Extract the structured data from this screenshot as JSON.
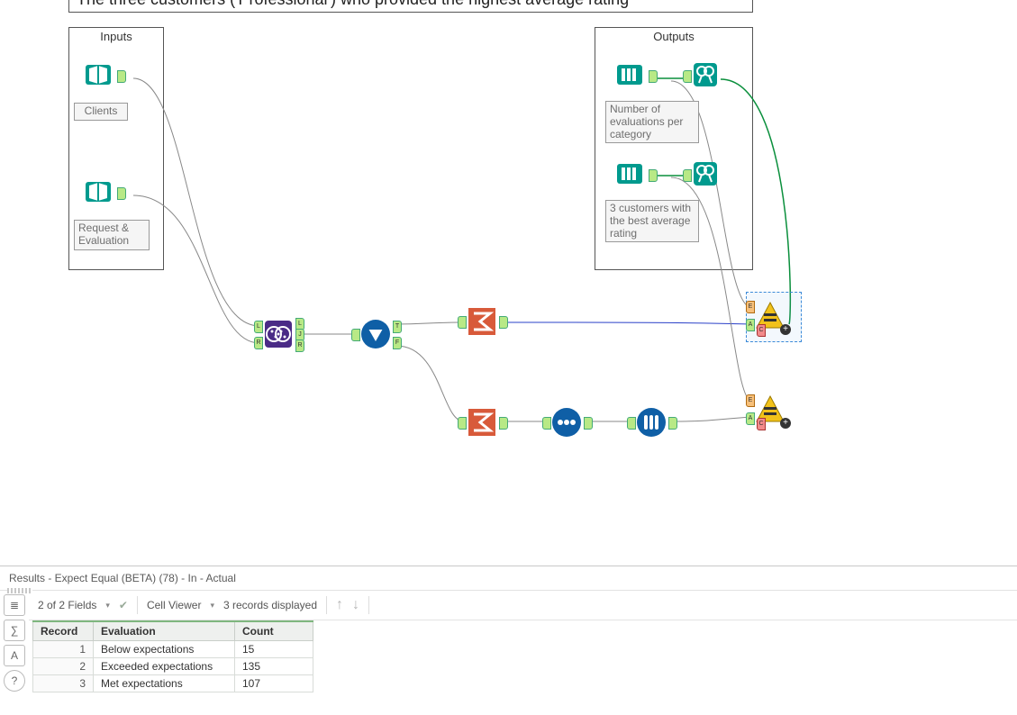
{
  "title_text": "The three customers ('Professional') who provided the highest average rating",
  "inputs_container": {
    "title": "Inputs"
  },
  "outputs_container": {
    "title": "Outputs"
  },
  "nodes": {
    "clients": {
      "label": "Clients"
    },
    "request_eval": {
      "label": "Request & Evaluation"
    },
    "out1": {
      "label": "Number of evaluations per category"
    },
    "out2": {
      "label": "3 customers with the best average rating"
    }
  },
  "anchors": {
    "L": "L",
    "J": "J",
    "R": "R",
    "T": "T",
    "F": "F",
    "E": "E",
    "A": "A",
    "C": "C"
  },
  "results": {
    "title": "Results - Expect Equal (BETA) (78) - In - Actual",
    "fields_summary": "2 of 2 Fields",
    "cell_viewer_label": "Cell Viewer",
    "records_summary": "3 records displayed",
    "columns": {
      "record": "Record",
      "evaluation": "Evaluation",
      "count": "Count"
    },
    "rows": [
      {
        "record": "1",
        "evaluation": "Below expectations",
        "count": "15"
      },
      {
        "record": "2",
        "evaluation": "Exceeded expectations",
        "count": "135"
      },
      {
        "record": "3",
        "evaluation": "Met expectations",
        "count": "107"
      }
    ]
  },
  "colors": {
    "teal": "#009a8e",
    "purple": "#4a2b86",
    "blue": "#0f5fa6",
    "orange": "#d85a3a",
    "yellow": "#f2c21a"
  }
}
